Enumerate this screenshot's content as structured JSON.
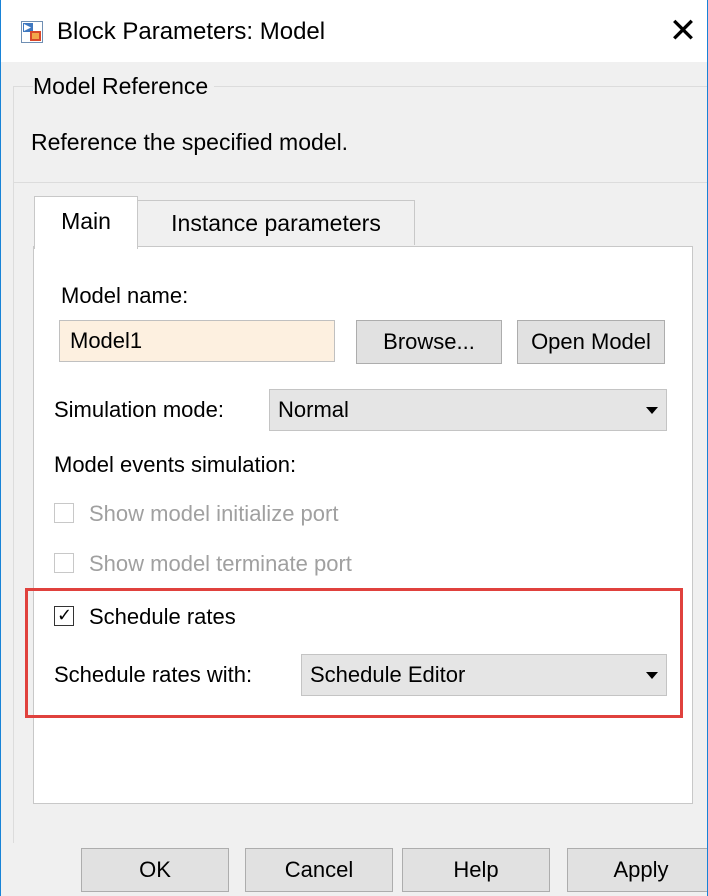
{
  "window": {
    "title": "Block Parameters: Model",
    "close_glyph": "✕"
  },
  "group": {
    "title": "Model Reference",
    "description": "Reference the specified model."
  },
  "tabs": [
    {
      "label": "Main",
      "active": true
    },
    {
      "label": "Instance parameters",
      "active": false
    }
  ],
  "main": {
    "model_name_label": "Model name:",
    "model_name_value": "Model1",
    "browse_label": "Browse...",
    "open_model_label": "Open Model",
    "simulation_mode_label": "Simulation mode:",
    "simulation_mode_value": "Normal",
    "model_events_label": "Model events simulation:",
    "show_initialize_label": "Show model initialize port",
    "show_terminate_label": "Show model terminate port",
    "schedule_rates_label": "Schedule rates",
    "schedule_rates_checked": true,
    "schedule_rates_with_label": "Schedule rates with:",
    "schedule_rates_with_value": "Schedule Editor"
  },
  "buttons": {
    "ok": "OK",
    "cancel": "Cancel",
    "help": "Help",
    "apply": "Apply"
  },
  "colors": {
    "highlight": "#e0413d",
    "input_bg": "#fdf0e0",
    "window_border": "#1883d7"
  }
}
